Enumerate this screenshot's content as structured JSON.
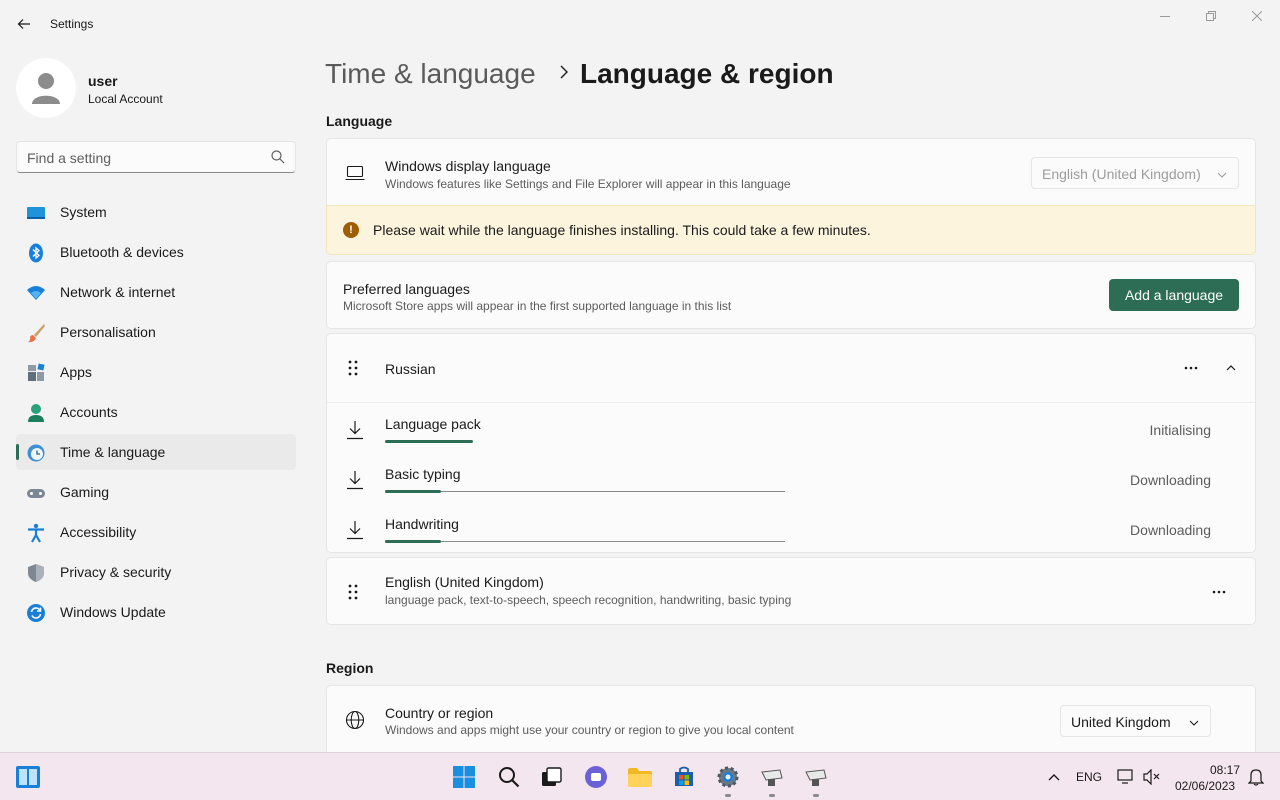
{
  "window": {
    "title": "Settings"
  },
  "profile": {
    "name": "user",
    "account_type": "Local Account"
  },
  "search": {
    "placeholder": "Find a setting"
  },
  "sidebar": {
    "items": [
      {
        "label": "System",
        "icon": "system-icon"
      },
      {
        "label": "Bluetooth & devices",
        "icon": "bluetooth-icon"
      },
      {
        "label": "Network & internet",
        "icon": "wifi-icon"
      },
      {
        "label": "Personalisation",
        "icon": "brush-icon"
      },
      {
        "label": "Apps",
        "icon": "apps-icon"
      },
      {
        "label": "Accounts",
        "icon": "accounts-icon"
      },
      {
        "label": "Time & language",
        "icon": "time-language-icon",
        "active": true
      },
      {
        "label": "Gaming",
        "icon": "gamepad-icon"
      },
      {
        "label": "Accessibility",
        "icon": "accessibility-icon"
      },
      {
        "label": "Privacy & security",
        "icon": "shield-icon"
      },
      {
        "label": "Windows Update",
        "icon": "update-icon"
      }
    ]
  },
  "breadcrumb": {
    "parent": "Time & language",
    "current": "Language & region"
  },
  "language_section": {
    "heading": "Language",
    "display_language": {
      "title": "Windows display language",
      "subtitle": "Windows features like Settings and File Explorer will appear in this language",
      "value": "English (United Kingdom)"
    },
    "warning": "Please wait while the language finishes installing. This could take a few minutes.",
    "preferred": {
      "title": "Preferred languages",
      "subtitle": "Microsoft Store apps will appear in the first supported language in this list",
      "button": "Add a language"
    },
    "russian": {
      "name": "Russian",
      "items": [
        {
          "label": "Language pack",
          "status": "Initialising",
          "progress": 0.22
        },
        {
          "label": "Basic typing",
          "status": "Downloading",
          "progress": 0.14
        },
        {
          "label": "Handwriting",
          "status": "Downloading",
          "progress": 0.14
        }
      ]
    },
    "english": {
      "name": "English (United Kingdom)",
      "features": "language pack, text-to-speech, speech recognition, handwriting, basic typing"
    }
  },
  "region_section": {
    "heading": "Region",
    "country": {
      "title": "Country or region",
      "subtitle": "Windows and apps might use your country or region to give you local content",
      "value": "United Kingdom"
    }
  },
  "taskbar": {
    "language": "ENG",
    "time": "08:17",
    "date": "02/06/2023"
  },
  "colors": {
    "accent": "#2d6d55",
    "warning_bg": "#fcf4dd",
    "warning_icon": "#9d5d00"
  }
}
